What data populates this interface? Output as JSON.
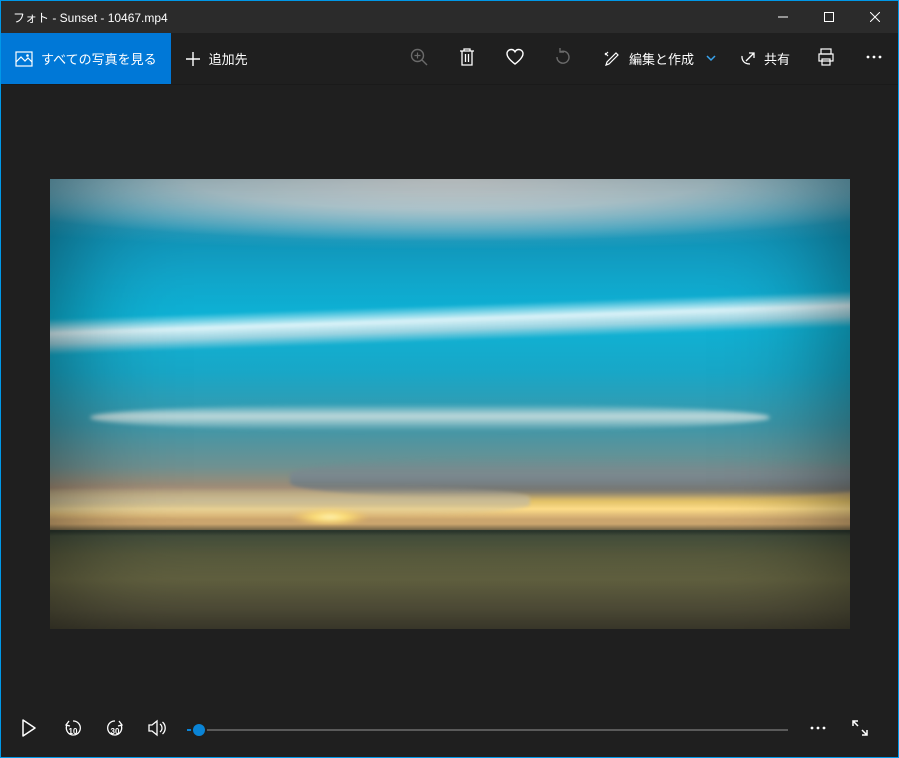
{
  "window": {
    "title": "フォト - Sunset - 10467.mp4"
  },
  "toolbar": {
    "see_all_label": "すべての写真を見る",
    "add_to_label": "追加先",
    "edit_create_label": "編集と作成",
    "share_label": "共有"
  },
  "playback": {
    "skip_back_seconds": "10",
    "skip_fwd_seconds": "30",
    "progress_percent": 2
  },
  "colors": {
    "accent": "#0078d7",
    "window_border": "#0098e8",
    "panel_bg": "#1f1f1f",
    "titlebar_bg": "#2b2b2b"
  }
}
